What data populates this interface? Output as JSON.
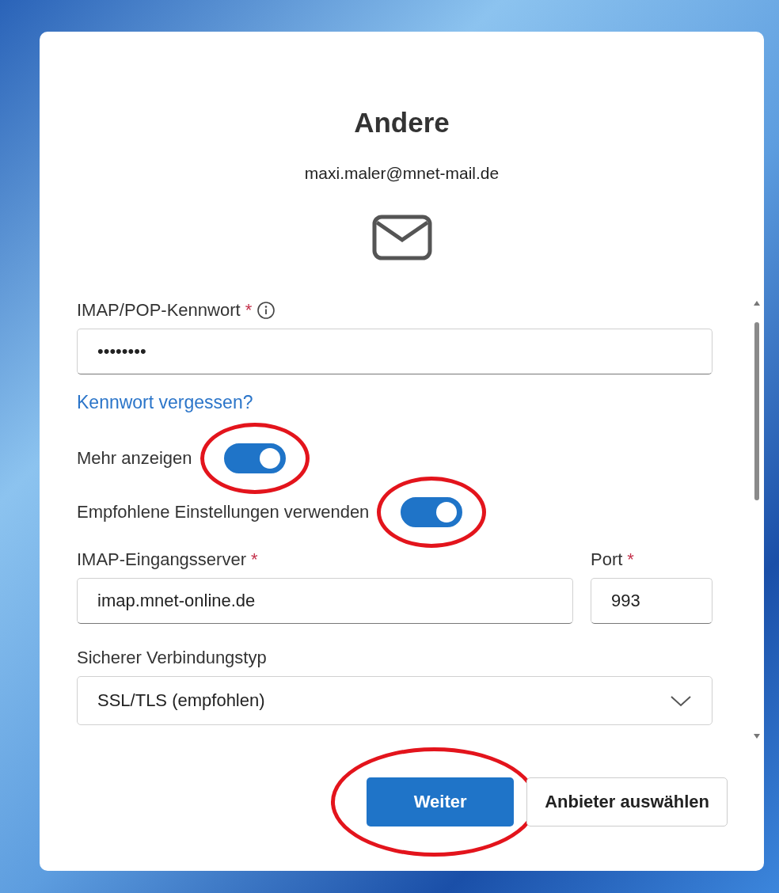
{
  "dialog": {
    "title": "Andere",
    "account": "maxi.maler@mnet-mail.de",
    "password": {
      "label": "IMAP/POP-Kennwort",
      "required_mark": "*",
      "value": "••••••••"
    },
    "forgot_link": "Kennwort vergessen?",
    "toggles": [
      {
        "label": "Mehr anzeigen",
        "on": true,
        "highlighted": true
      },
      {
        "label": "Empfohlene Einstellungen verwenden",
        "on": true,
        "highlighted": true
      }
    ],
    "server": {
      "label": "IMAP-Eingangsserver",
      "required_mark": "*",
      "value": "imap.mnet-online.de"
    },
    "port": {
      "label": "Port",
      "required_mark": "*",
      "value": "993"
    },
    "connection": {
      "label": "Sicherer Verbindungstyp",
      "value": "SSL/TLS (empfohlen)"
    },
    "buttons": [
      {
        "label": "Weiter",
        "kind": "primary",
        "highlighted": true
      },
      {
        "label": "Anbieter auswählen",
        "kind": "secondary",
        "highlighted": false
      }
    ]
  }
}
